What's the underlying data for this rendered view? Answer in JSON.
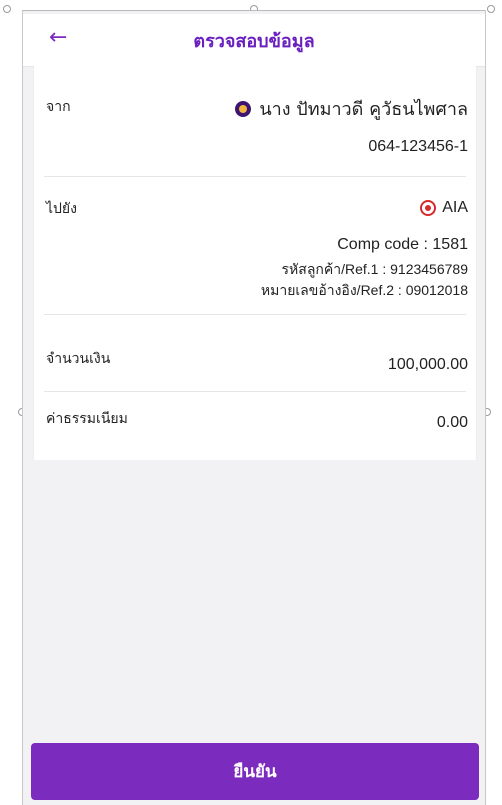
{
  "header": {
    "title": "ตรวจสอบข้อมูล",
    "back_icon": "arrow-left-icon"
  },
  "transfer": {
    "from": {
      "label": "จาก",
      "name": "นาง ปัทมาวดี คูวัธนไพศาล",
      "account": "064-123456-1",
      "icon": "bank-logo-icon"
    },
    "to": {
      "label": "ไปยัง",
      "name": "AIA",
      "icon": "aia-logo-icon",
      "comp_code": "Comp code : 1581",
      "ref1": "รหัสลูกค้า/Ref.1 : 9123456789",
      "ref2": "หมายเลขอ้างอิง/Ref.2 : 09012018"
    },
    "amount": {
      "label": "จำนวนเงิน",
      "value": "100,000.00"
    },
    "fee": {
      "label": "ค่าธรรมเนียม",
      "value": "0.00"
    }
  },
  "footer": {
    "confirm_label": "ยืนยัน"
  },
  "colors": {
    "accent": "#7b2cbf",
    "background": "#f2f2f5"
  }
}
